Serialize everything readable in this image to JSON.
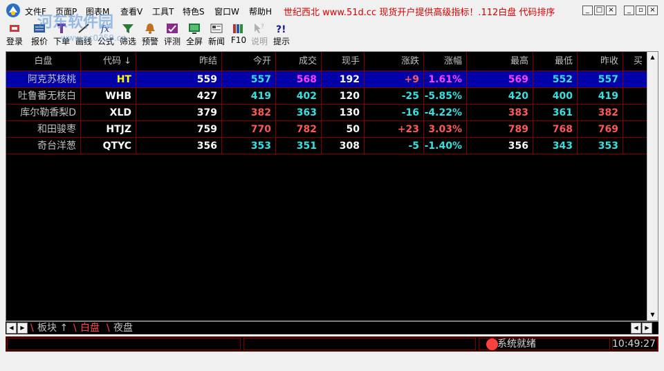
{
  "menu": {
    "items": [
      "文件F",
      "页面P",
      "图表M",
      "查看V",
      "工具T",
      "特色S",
      "窗口W",
      "帮助H"
    ],
    "marquee": "世纪西北 www.51d.cc 现货开户提供高级指标！.112白盘 代码排序"
  },
  "toolbar": {
    "items": [
      {
        "label": "登录",
        "icon": "login-icon"
      },
      {
        "label": "报价",
        "icon": "quote-icon"
      },
      {
        "label": "下单",
        "icon": "order-icon"
      },
      {
        "label": "画线",
        "icon": "draw-line-icon"
      },
      {
        "label": "公式",
        "icon": "formula-icon"
      },
      {
        "label": "筛选",
        "icon": "filter-icon"
      },
      {
        "label": "预警",
        "icon": "alert-bell-icon"
      },
      {
        "label": "评测",
        "icon": "evaluate-icon"
      },
      {
        "label": "全屏",
        "icon": "fullscreen-icon"
      },
      {
        "label": "新闻",
        "icon": "news-icon"
      },
      {
        "label": "F10",
        "icon": "f10-books-icon"
      },
      {
        "label": "说明",
        "icon": "help-cursor-icon"
      },
      {
        "label": "提示",
        "icon": "tips-icon"
      }
    ],
    "watermark": "河东软件园",
    "watermark_sub": "www.pc0359.cn"
  },
  "grid": {
    "columns": [
      "白盘",
      "代码 ↓",
      "昨结",
      "今开",
      "成交",
      "现手",
      "涨跌",
      "涨幅",
      "最高",
      "最低",
      "昨收",
      "买"
    ],
    "rows": [
      {
        "name": "阿克苏核桃",
        "code": "HT",
        "prev_settle": "559",
        "open": "557",
        "last": "568",
        "vol": "192",
        "chg": "+9",
        "pct": "1.61%",
        "high": "569",
        "low": "552",
        "prev_close": "557",
        "selected": true
      },
      {
        "name": "吐鲁番无核白",
        "code": "WHB",
        "prev_settle": "427",
        "open": "419",
        "last": "402",
        "vol": "120",
        "chg": "-25",
        "pct": "-5.85%",
        "high": "420",
        "low": "400",
        "prev_close": "419",
        "selected": false
      },
      {
        "name": "库尔勒香梨D",
        "code": "XLD",
        "prev_settle": "379",
        "open": "382",
        "last": "363",
        "vol": "130",
        "chg": "-16",
        "pct": "-4.22%",
        "high": "383",
        "low": "361",
        "prev_close": "382",
        "selected": false
      },
      {
        "name": "和田骏枣",
        "code": "HTJZ",
        "prev_settle": "759",
        "open": "770",
        "last": "782",
        "vol": "50",
        "chg": "+23",
        "pct": "3.03%",
        "high": "789",
        "low": "768",
        "prev_close": "769",
        "selected": false
      },
      {
        "name": "奇台洋葱",
        "code": "QTYC",
        "prev_settle": "356",
        "open": "353",
        "last": "351",
        "vol": "308",
        "chg": "-5",
        "pct": "-1.40%",
        "high": "356",
        "low": "343",
        "prev_close": "353",
        "selected": false
      }
    ]
  },
  "tabs": {
    "items": [
      "板块 ↑",
      "白盘",
      "夜盘"
    ],
    "active": "白盘"
  },
  "status": {
    "text": "系统就绪",
    "time": "10:49:27"
  },
  "colors": {
    "up": "#ff5a5a",
    "down": "#39e0e0",
    "highlight": "#ff40ff",
    "selected_row": "#0000a8",
    "grid_line": "#7a0000",
    "marquee": "#d40000"
  }
}
